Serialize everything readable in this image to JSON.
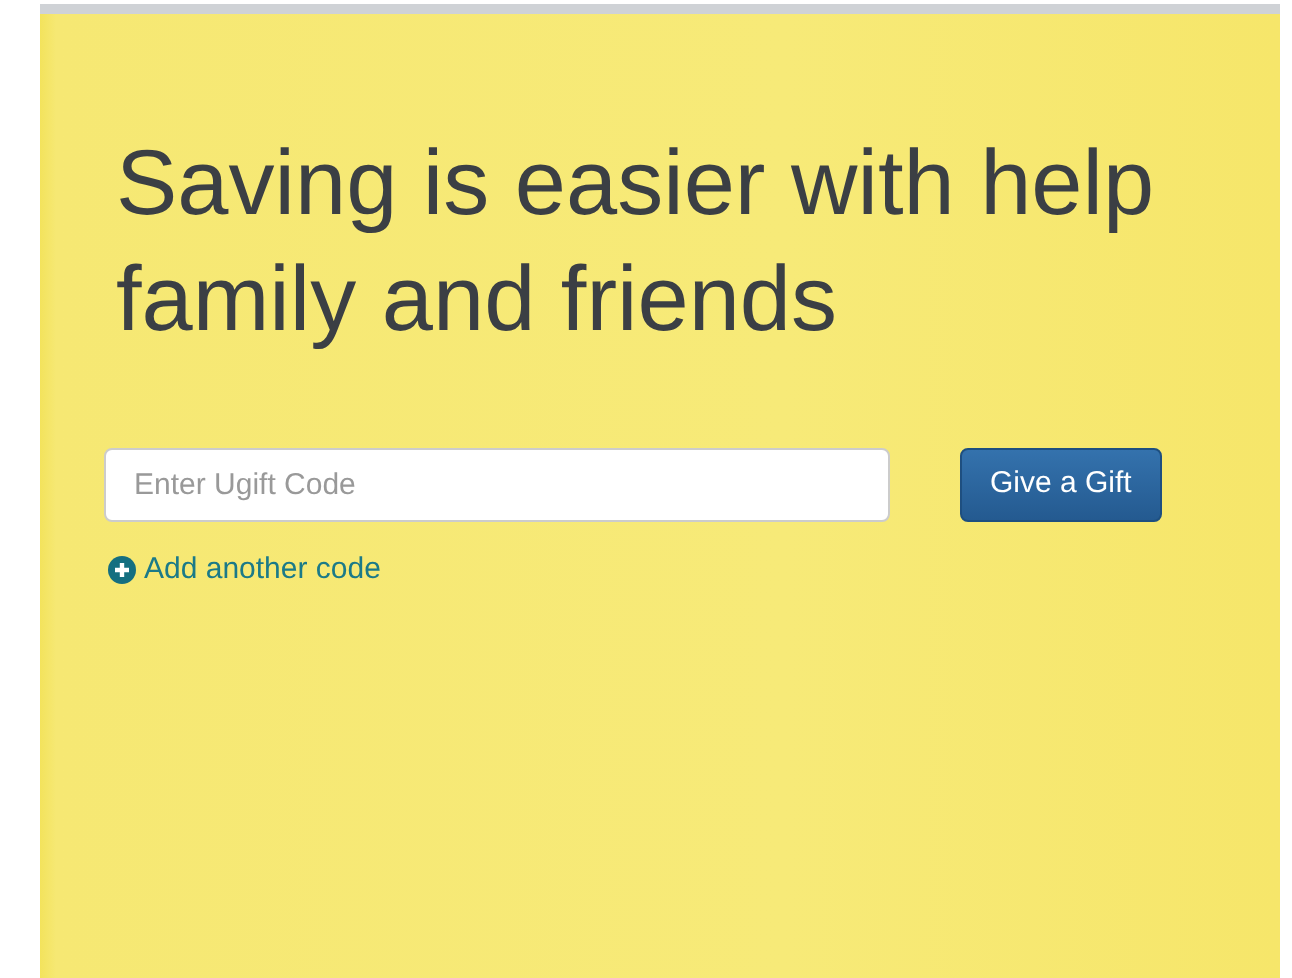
{
  "heading": {
    "lines": [
      "Saving is easier with help",
      "family and friends"
    ]
  },
  "gift_form": {
    "code_field": {
      "placeholder": "Enter Ugift Code"
    },
    "submit_button": "Give a Gift",
    "add_link": "Add another code"
  }
}
